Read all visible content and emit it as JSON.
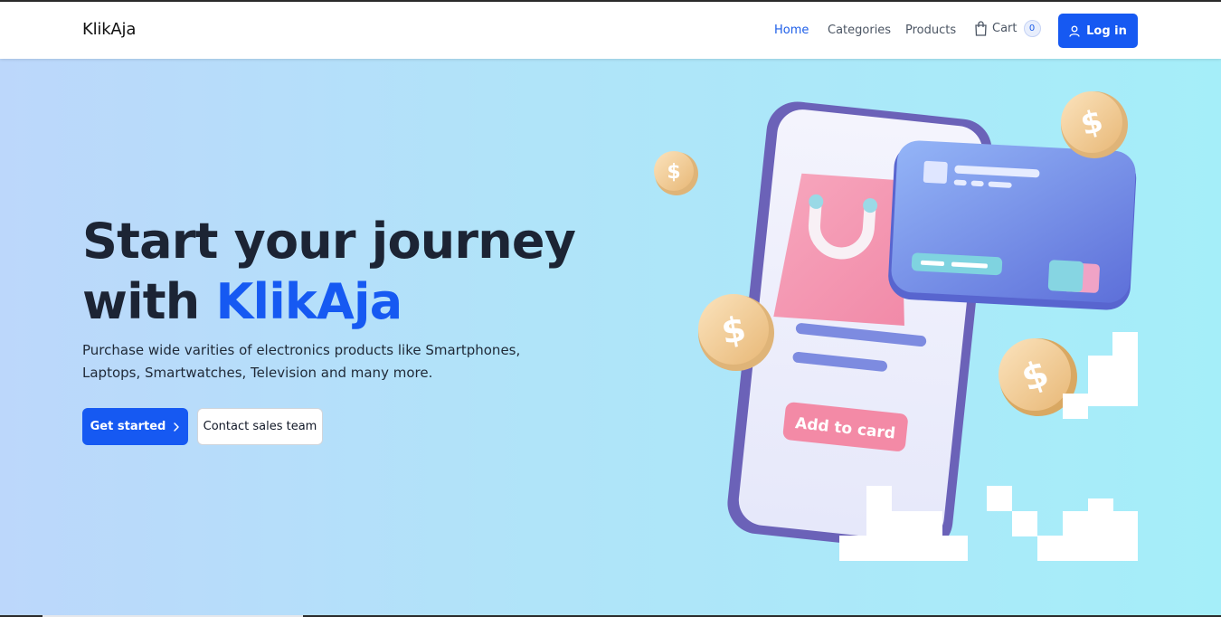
{
  "navbar": {
    "brand": "KlikAja",
    "links": [
      {
        "label": "Home",
        "active": true
      },
      {
        "label": "Categories",
        "active": false
      },
      {
        "label": "Products",
        "active": false
      }
    ],
    "cart": {
      "label": "Cart",
      "count": "0",
      "icon": "shopping-bag-icon"
    },
    "login": {
      "label": "Log in",
      "icon": "user-icon"
    }
  },
  "hero": {
    "headline_line1": "Start your journey",
    "headline_prefix": "with ",
    "headline_accent": "KlikAja",
    "lead": "Purchase wide varities of electronics products like Smartphones, Laptops, Smartwatches, Television and many more.",
    "primary_button": "Get started",
    "secondary_button": "Contact sales team"
  },
  "illustration": {
    "add_button_label": "Add to card",
    "coin_symbol": "$"
  },
  "colors": {
    "accent": "#1659f2",
    "headline": "#1c2434",
    "hero_gradient_start": "#bcd7fb",
    "hero_gradient_end": "#a5eef9"
  }
}
